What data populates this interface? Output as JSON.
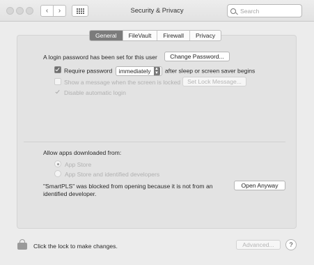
{
  "window": {
    "title": "Security & Privacy"
  },
  "toolbar": {
    "back": "‹",
    "forward": "›"
  },
  "search": {
    "placeholder": "Search"
  },
  "tabs": [
    {
      "label": "General",
      "active": true
    },
    {
      "label": "FileVault",
      "active": false
    },
    {
      "label": "Firewall",
      "active": false
    },
    {
      "label": "Privacy",
      "active": false
    }
  ],
  "general": {
    "login_text": "A login password has been set for this user",
    "change_password_label": "Change Password...",
    "require_password_label": "Require password",
    "require_password_value": "immediately",
    "require_password_suffix": "after sleep or screen saver begins",
    "show_message_label": "Show a message when the screen is locked",
    "set_lock_message_label": "Set Lock Message...",
    "disable_auto_login_label": "Disable automatic login"
  },
  "apps": {
    "heading": "Allow apps downloaded from:",
    "option_app_store": "App Store",
    "option_identified": "App Store and identified developers",
    "blocked_line1": "\"SmartPLS\" was blocked from opening because it is not from an",
    "blocked_line2": "identified developer.",
    "open_anyway_label": "Open Anyway"
  },
  "footer": {
    "lock_text": "Click the lock to make changes.",
    "advanced_label": "Advanced...",
    "help_label": "?"
  },
  "colors": {
    "active_tab": "#7b7b7b",
    "window_bg": "#ececec"
  }
}
